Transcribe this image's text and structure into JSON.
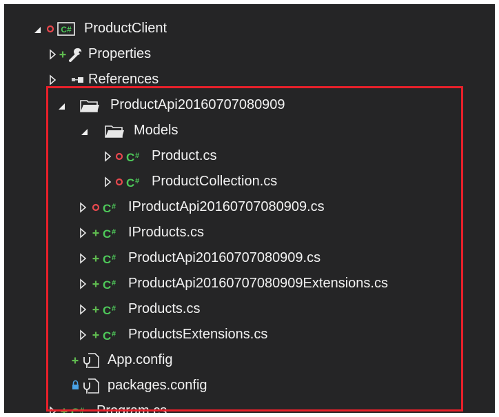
{
  "tree": [
    {
      "label": "ProductClient",
      "expand": "expanded",
      "status": "red",
      "icon": "csharp-project-icon"
    },
    {
      "label": "Properties",
      "expand": "collapsed",
      "status": "plus",
      "icon": "wrench-icon"
    },
    {
      "label": "References",
      "expand": "collapsed",
      "status": "none",
      "icon": "references-icon"
    },
    {
      "label": "ProductApi20160707080909",
      "expand": "expanded",
      "status": "none",
      "icon": "folder-icon"
    },
    {
      "label": "Models",
      "expand": "expanded",
      "status": "none",
      "icon": "folder-icon"
    },
    {
      "label": "Product.cs",
      "expand": "collapsed",
      "status": "red",
      "icon": "csharp-file-icon"
    },
    {
      "label": "ProductCollection.cs",
      "expand": "collapsed",
      "status": "red",
      "icon": "csharp-file-icon"
    },
    {
      "label": "IProductApi20160707080909.cs",
      "expand": "collapsed",
      "status": "red",
      "icon": "csharp-file-icon"
    },
    {
      "label": "IProducts.cs",
      "expand": "collapsed",
      "status": "plus",
      "icon": "csharp-file-icon"
    },
    {
      "label": "ProductApi20160707080909.cs",
      "expand": "collapsed",
      "status": "plus",
      "icon": "csharp-file-icon"
    },
    {
      "label": "ProductApi20160707080909Extensions.cs",
      "expand": "collapsed",
      "status": "plus",
      "icon": "csharp-file-icon"
    },
    {
      "label": "Products.cs",
      "expand": "collapsed",
      "status": "plus",
      "icon": "csharp-file-icon"
    },
    {
      "label": "ProductsExtensions.cs",
      "expand": "collapsed",
      "status": "plus",
      "icon": "csharp-file-icon"
    },
    {
      "label": "App.config",
      "expand": "none",
      "status": "plus",
      "icon": "config-file-icon"
    },
    {
      "label": "packages.config",
      "expand": "none",
      "status": "lock",
      "icon": "config-file-icon"
    },
    {
      "label": "Program.cs",
      "expand": "collapsed",
      "status": "plus",
      "icon": "csharp-file-icon"
    }
  ],
  "colors": {
    "background": "#252526",
    "text": "#f1f1f1",
    "csharp_green": "#4ec95a",
    "status_red": "#e8484e",
    "status_plus": "#5fba4f",
    "lock_blue": "#4aa3e8",
    "highlight_red": "#e8202a"
  }
}
